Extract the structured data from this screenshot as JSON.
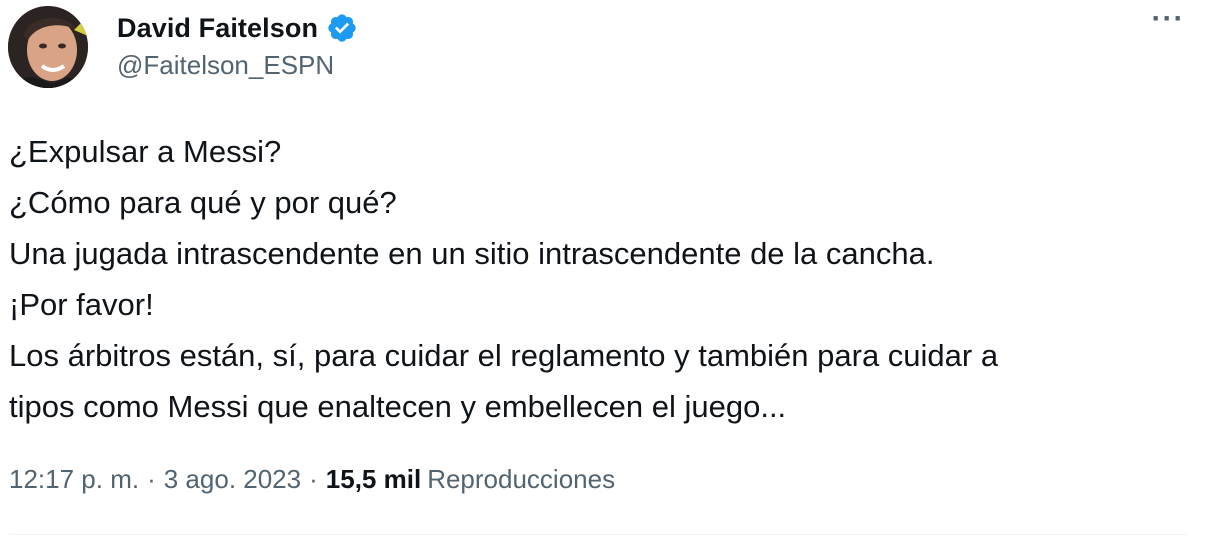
{
  "author": {
    "display_name": "David Faitelson",
    "handle": "@Faitelson_ESPN",
    "verified": true,
    "verified_color": "#1d9bf0"
  },
  "tweet": {
    "lines": [
      "¿Expulsar a Messi?",
      "¿Cómo para qué y por qué?",
      "Una jugada intrascendente en un sitio intrascendente de la cancha.",
      "¡Por favor!",
      "Los árbitros están, sí, para cuidar el reglamento y también para cuidar a",
      "tipos como Messi que enaltecen y embellecen el juego..."
    ]
  },
  "meta": {
    "time": "12:17 p. m.",
    "separator": "·",
    "date": "3 ago. 2023",
    "views_count": "15,5 mil",
    "views_label": "Reproducciones"
  },
  "menu": {
    "more_label": "···"
  },
  "icons": {
    "verified": "verified-badge-icon",
    "more": "more-options-icon"
  }
}
